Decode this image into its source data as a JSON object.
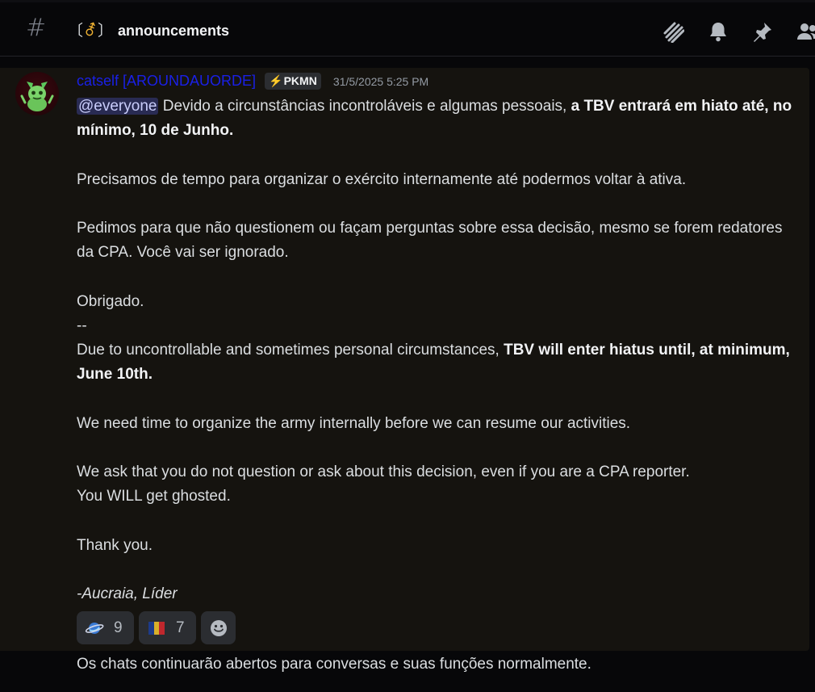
{
  "header": {
    "channel_emoji_open": "〔",
    "channel_emoji_symbol": "⚦",
    "channel_emoji_close": "〕",
    "channel_name": "announcements",
    "icons": [
      "threads-icon",
      "bell-icon",
      "pin-icon",
      "members-icon"
    ]
  },
  "message": {
    "username": "catself [AROUNDAUORDE]",
    "username_color": "#1a20e6",
    "tag_icon": "⚡",
    "tag_label": "PKMN",
    "timestamp": "31/5/2025 5:25 PM",
    "mention": "@everyone",
    "p1_text": " Devido a circunstâncias incontroláveis e algumas pessoais, ",
    "p1_bold": "a TBV entrará em hiato até, no mínimo, 10 de Junho.",
    "p2": "Precisamos de tempo para organizar o exército internamente até podermos voltar à ativa.",
    "p3": "Pedimos para que não questionem ou façam perguntas sobre essa decisão, mesmo se forem redatores da CPA. Você vai ser ignorado.",
    "p4": "Obrigado.",
    "separator": "--",
    "p5_text": "Due to uncontrollable and sometimes personal circumstances, ",
    "p5_bold": "TBV will enter hiatus until, at minimum, June 10th.",
    "p6": "We need time to organize the army internally before we can resume our activities.",
    "p7_line1": "We ask that you do not question or ask about this decision, even if you are a CPA reporter.",
    "p7_line2": "You WILL get ghosted.",
    "p8": "Thank you.",
    "signature": "-Aucraia, Líder"
  },
  "reactions": [
    {
      "emoji": "planet-emoji",
      "count": "9"
    },
    {
      "emoji": "flag-emoji",
      "count": "7"
    }
  ],
  "next_message": "Os chats continuarão abertos para conversas e suas funções normalmente."
}
